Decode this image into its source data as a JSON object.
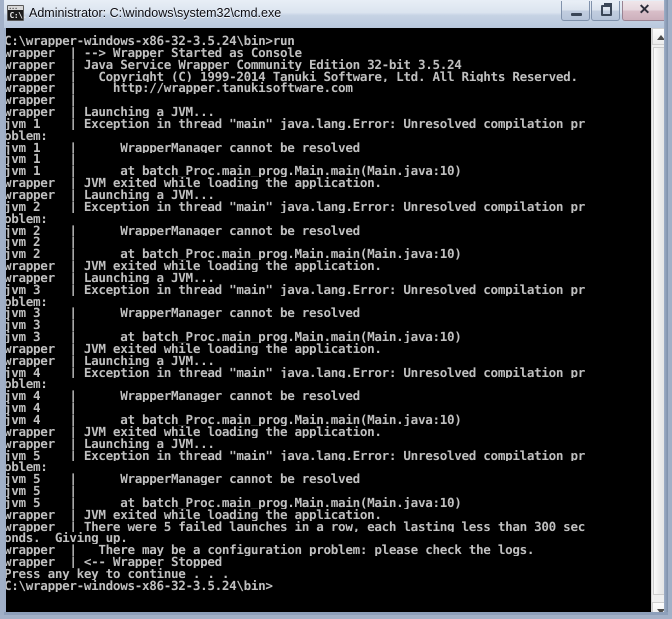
{
  "window": {
    "title": "Administrator: C:\\windows\\system32\\cmd.exe",
    "icon_name": "cmd-console-icon",
    "icon_prompt_text": "C:\\.",
    "controls": {
      "minimize_label": "Minimize",
      "maximize_label": "Restore Down",
      "close_label": "Close",
      "close_glyph": "✕"
    },
    "colors": {
      "console_background": "#000000",
      "console_foreground": "#c0c0c0",
      "titlebar_start": "#e8eef6",
      "titlebar_end": "#b9c8dd",
      "frame": "#9eaec6"
    }
  },
  "scrollbar": {
    "up_arrow_name": "scroll-up-arrow",
    "down_arrow_name": "scroll-down-arrow",
    "thumb_name": "scroll-thumb"
  },
  "console": {
    "prompt_path": "C:\\wrapper-windows-x86-32-3.5.24\\bin>",
    "command": "run",
    "lines": [
      "C:\\wrapper-windows-x86-32-3.5.24\\bin>run",
      "wrapper  | --> Wrapper Started as Console",
      "wrapper  | Java Service Wrapper Community Edition 32-bit 3.5.24",
      "wrapper  |   Copyright (C) 1999-2014 Tanuki Software, Ltd. All Rights Reserved.",
      "wrapper  |     http://wrapper.tanukisoftware.com",
      "wrapper  |",
      "wrapper  | Launching a JVM...",
      "jvm 1    | Exception in thread \"main\" java.lang.Error: Unresolved compilation pr",
      "oblem:",
      "jvm 1    |      WrapperManager cannot be resolved",
      "jvm 1    |",
      "jvm 1    |      at batch_Proc.main_prog.Main.main(Main.java:10)",
      "wrapper  | JVM exited while loading the application.",
      "wrapper  | Launching a JVM...",
      "jvm 2    | Exception in thread \"main\" java.lang.Error: Unresolved compilation pr",
      "oblem:",
      "jvm 2    |      WrapperManager cannot be resolved",
      "jvm 2    |",
      "jvm 2    |      at batch_Proc.main_prog.Main.main(Main.java:10)",
      "wrapper  | JVM exited while loading the application.",
      "wrapper  | Launching a JVM...",
      "jvm 3    | Exception in thread \"main\" java.lang.Error: Unresolved compilation pr",
      "oblem:",
      "jvm 3    |      WrapperManager cannot be resolved",
      "jvm 3    |",
      "jvm 3    |      at batch_Proc.main_prog.Main.main(Main.java:10)",
      "wrapper  | JVM exited while loading the application.",
      "wrapper  | Launching a JVM...",
      "jvm 4    | Exception in thread \"main\" java.lang.Error: Unresolved compilation pr",
      "oblem:",
      "jvm 4    |      WrapperManager cannot be resolved",
      "jvm 4    |",
      "jvm 4    |      at batch_Proc.main_prog.Main.main(Main.java:10)",
      "wrapper  | JVM exited while loading the application.",
      "wrapper  | Launching a JVM...",
      "jvm 5    | Exception in thread \"main\" java.lang.Error: Unresolved compilation pr",
      "oblem:",
      "jvm 5    |      WrapperManager cannot be resolved",
      "jvm 5    |",
      "jvm 5    |      at batch_Proc.main_prog.Main.main(Main.java:10)",
      "wrapper  | JVM exited while loading the application.",
      "wrapper  | There were 5 failed launches in a row, each lasting less than 300 sec",
      "onds.  Giving up.",
      "wrapper  |   There may be a configuration problem: please check the logs.",
      "wrapper  | <-- Wrapper Stopped",
      "Press any key to continue . . .",
      "C:\\wrapper-windows-x86-32-3.5.24\\bin>"
    ]
  }
}
